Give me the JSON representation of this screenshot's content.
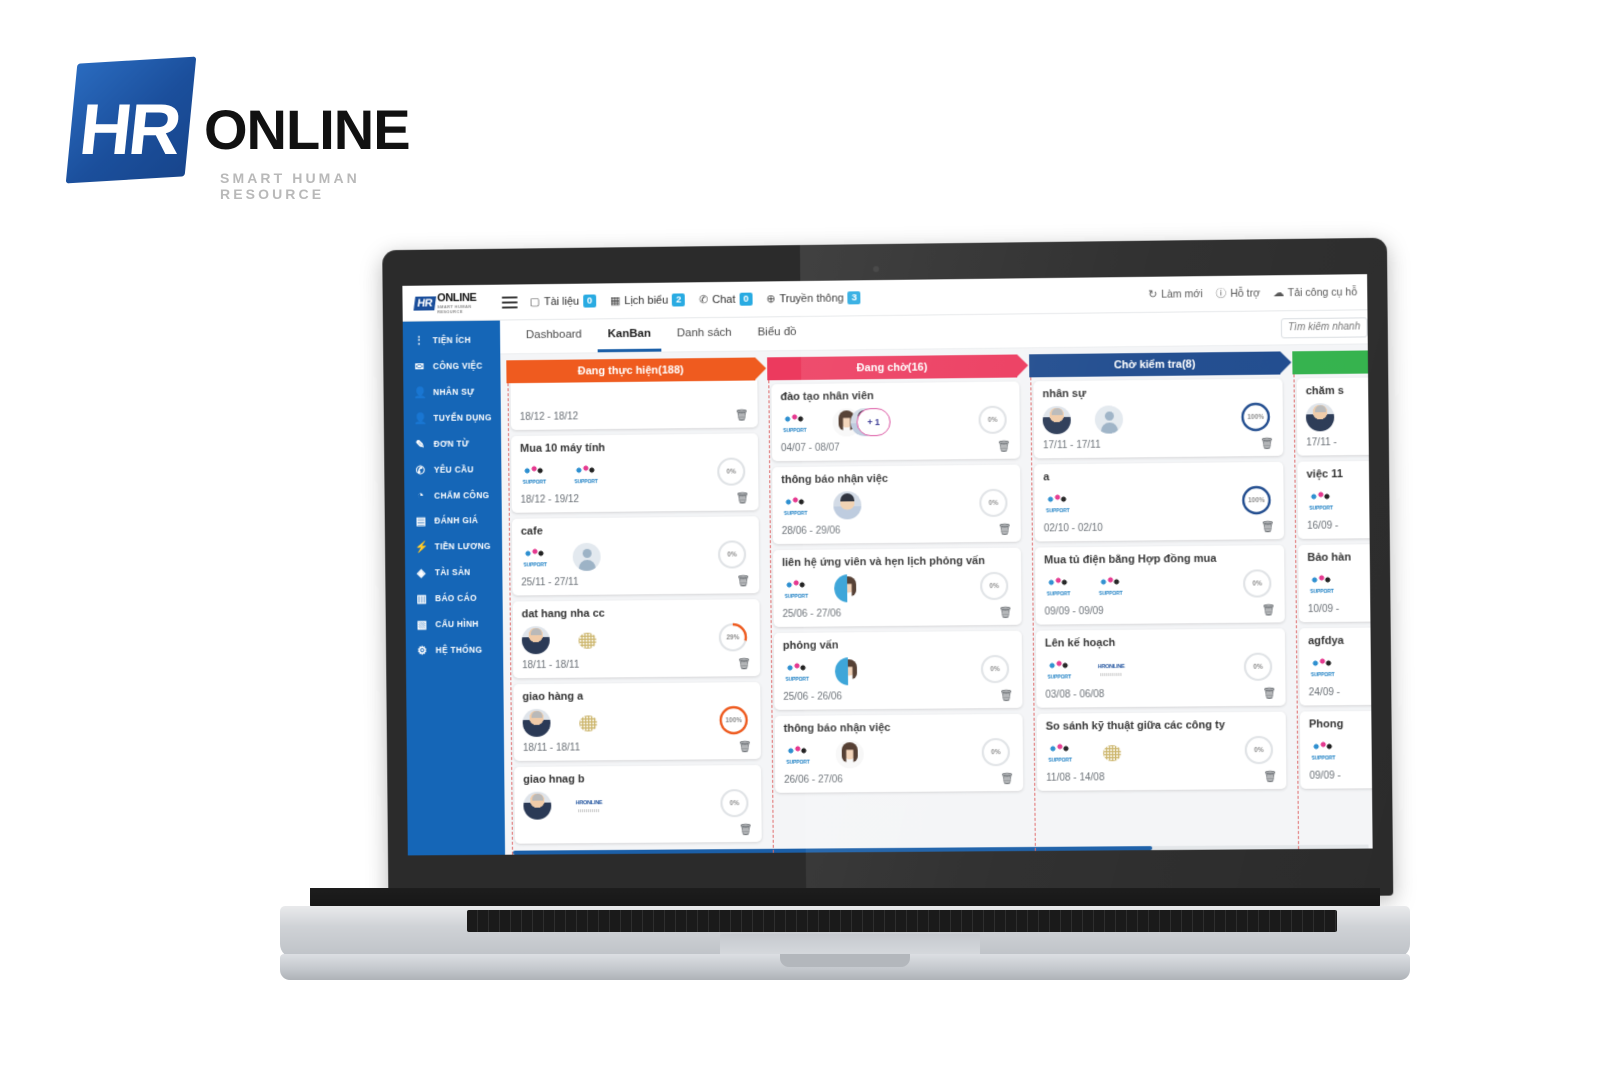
{
  "brand": {
    "hr": "HR",
    "online": "ONLINE",
    "tagline": "SMART HUMAN RESOURCE"
  },
  "topbar": {
    "logo_mark": "HR",
    "logo_text": "ONLINE",
    "logo_sub": "SMART HUMAN RESOURCE",
    "nav": [
      {
        "icon": "document-icon",
        "glyph": "▢",
        "label": "Tài liệu",
        "badge": "0"
      },
      {
        "icon": "calendar-icon",
        "glyph": "▦",
        "label": "Lịch biểu",
        "badge": "2"
      },
      {
        "icon": "chat-icon",
        "glyph": "✆",
        "label": "Chat",
        "badge": "0"
      },
      {
        "icon": "globe-icon",
        "glyph": "⊕",
        "label": "Truyền thông",
        "badge": "3"
      }
    ],
    "right": [
      {
        "icon": "refresh-icon",
        "glyph": "↻",
        "label": "Làm mới"
      },
      {
        "icon": "info-icon",
        "glyph": "ⓘ",
        "label": "Hỗ trợ"
      },
      {
        "icon": "cloud-download-icon",
        "glyph": "☁",
        "label": "Tải công cụ hỗ"
      }
    ],
    "badge_color": "#29abe2"
  },
  "sidebar": {
    "bg": "#1566b7",
    "items": [
      {
        "icon": "dots-vertical-icon",
        "glyph": "⋮",
        "label": "TIỆN ÍCH"
      },
      {
        "icon": "envelope-icon",
        "glyph": "✉",
        "label": "CÔNG VIỆC"
      },
      {
        "icon": "user-icon",
        "glyph": "👤",
        "label": "NHÂN SỰ"
      },
      {
        "icon": "user-plus-icon",
        "glyph": "👤",
        "label": "TUYỂN DỤNG"
      },
      {
        "icon": "edit-icon",
        "glyph": "✎",
        "label": "ĐƠN TỪ"
      },
      {
        "icon": "phone-icon",
        "glyph": "✆",
        "label": "YÊU CẦU"
      },
      {
        "icon": "clock-icon",
        "glyph": "◔",
        "label": "CHẤM CÔNG"
      },
      {
        "icon": "book-icon",
        "glyph": "▤",
        "label": "ĐÁNH GIÁ"
      },
      {
        "icon": "bolt-icon",
        "glyph": "⚡",
        "label": "TIỀN LƯƠNG"
      },
      {
        "icon": "diamond-icon",
        "glyph": "◈",
        "label": "TÀI SẢN"
      },
      {
        "icon": "bar-chart-icon",
        "glyph": "▥",
        "label": "BÁO CÁO"
      },
      {
        "icon": "layers-icon",
        "glyph": "▧",
        "label": "CẤU HÌNH"
      },
      {
        "icon": "gear-icon",
        "glyph": "⚙",
        "label": "HỆ THỐNG"
      }
    ]
  },
  "tabs": [
    {
      "label": "Dashboard",
      "active": false
    },
    {
      "label": "KanBan",
      "active": true
    },
    {
      "label": "Danh sách",
      "active": false
    },
    {
      "label": "Biểu đồ",
      "active": false
    }
  ],
  "search": {
    "placeholder": "Tìm kiếm nhanh",
    "value": ""
  },
  "board": {
    "columns": [
      {
        "title": "Đang thực hiện(188)",
        "color": "#ef5b1f",
        "partial_top_card": {
          "date": "18/12 - 18/12"
        },
        "cards": [
          {
            "title": "Mua 10 máy tính",
            "avatars": [
              "support",
              "support"
            ],
            "progress": "0%",
            "date": "18/12 - 19/12",
            "ring": "#dcdfe3"
          },
          {
            "title": "cafe",
            "avatars": [
              "support",
              "user"
            ],
            "progress": "0%",
            "date": "25/11 - 27/11",
            "ring": "#dcdfe3"
          },
          {
            "title": "dat hang nha cc",
            "avatars": [
              "man",
              "grid"
            ],
            "progress": "29%",
            "date": "18/11 - 18/11",
            "ring": "#ef5b1f"
          },
          {
            "title": "giao hàng a",
            "avatars": [
              "man",
              "grid"
            ],
            "progress": "100%",
            "date": "18/11 - 18/11",
            "ring": "#ef5b1f"
          },
          {
            "title": "giao hnag b",
            "avatars": [
              "man",
              "hronline"
            ],
            "progress": "0%",
            "date": "",
            "ring": "#dcdfe3"
          }
        ]
      },
      {
        "title": "Đang chờ(16)",
        "color": "#e8२",
        "cards": []
      }
    ],
    "columns_full": [
      {
        "id": "col-dang-thuc-hien",
        "title": "Đang thực hiện(188)",
        "color": "#ef5b1f",
        "partial_card_date": "18/12 - 18/12",
        "cards": [
          {
            "title": "Mua 10 máy tính",
            "avatars": [
              "support",
              "support"
            ],
            "progress": "0%",
            "progress_value": 0,
            "date": "18/12 - 19/12",
            "ring_color": "#dcdfe3"
          },
          {
            "title": "cafe",
            "avatars": [
              "support",
              "user"
            ],
            "progress": "0%",
            "progress_value": 0,
            "date": "25/11 - 27/11",
            "ring_color": "#dcdfe3"
          },
          {
            "title": "dat hang nha cc",
            "avatars": [
              "man",
              "grid"
            ],
            "progress": "29%",
            "progress_value": 29,
            "date": "18/11 - 18/11",
            "ring_color": "#ef5b1f"
          },
          {
            "title": "giao hàng a",
            "avatars": [
              "man",
              "grid"
            ],
            "progress": "100%",
            "progress_value": 100,
            "date": "18/11 - 18/11",
            "ring_color": "#ef5b1f"
          },
          {
            "title": "giao hnag b",
            "avatars": [
              "man",
              "hronline"
            ],
            "progress": "0%",
            "progress_value": 0,
            "date": "",
            "ring_color": "#dcdfe3"
          }
        ]
      },
      {
        "id": "col-dang-cho",
        "title": "Đang chờ(16)",
        "color": "#ec3a5e",
        "partial_card_date": "",
        "cards": [
          {
            "title": "đào tạo nhân viên",
            "avatars": [
              "support",
              "womanp",
              "boy",
              "plus"
            ],
            "plus_count": "1",
            "progress": "0%",
            "progress_value": 0,
            "date": "04/07 - 08/07",
            "ring_color": "#dcdfe3"
          },
          {
            "title": "thông báo nhận việc",
            "avatars": [
              "support",
              "boy"
            ],
            "progress": "0%",
            "progress_value": 0,
            "date": "28/06 - 29/06",
            "ring_color": "#dcdfe3"
          },
          {
            "title": "liên hệ ứng viên và hẹn lịch phỏng vấn",
            "avatars": [
              "support",
              "woman"
            ],
            "progress": "0%",
            "progress_value": 0,
            "date": "25/06 - 27/06",
            "ring_color": "#dcdfe3"
          },
          {
            "title": "phỏng vấn",
            "avatars": [
              "support",
              "woman"
            ],
            "progress": "0%",
            "progress_value": 0,
            "date": "25/06 - 26/06",
            "ring_color": "#dcdfe3"
          },
          {
            "title": "thông báo nhận việc",
            "avatars": [
              "support",
              "womanp"
            ],
            "progress": "0%",
            "progress_value": 0,
            "date": "26/06 - 27/06",
            "ring_color": "#dcdfe3"
          }
        ]
      },
      {
        "id": "col-cho-kiem-tra",
        "title": "Chờ kiểm tra(8)",
        "color": "#1f4b8e",
        "partial_card_date": "",
        "cards": [
          {
            "title": "nhân sự",
            "avatars": [
              "man",
              "user"
            ],
            "progress": "100%",
            "progress_value": 100,
            "date": "17/11 - 17/11",
            "ring_color": "#1f4b8e"
          },
          {
            "title": "a",
            "avatars": [
              "support"
            ],
            "progress": "100%",
            "progress_value": 100,
            "date": "02/10 - 02/10",
            "ring_color": "#1f4b8e"
          },
          {
            "title": "Mua tủ điện bằng Hợp đồng mua",
            "avatars": [
              "support",
              "support"
            ],
            "progress": "0%",
            "progress_value": 0,
            "date": "09/09 - 09/09",
            "ring_color": "#dcdfe3"
          },
          {
            "title": "Lên kế hoạch",
            "avatars": [
              "support",
              "hronline"
            ],
            "progress": "0%",
            "progress_value": 0,
            "date": "03/08 - 06/08",
            "ring_color": "#dcdfe3"
          },
          {
            "title": "So sánh kỹ thuật giữa các công ty",
            "avatars": [
              "support",
              "grid"
            ],
            "progress": "0%",
            "progress_value": 0,
            "date": "11/08 - 14/08",
            "ring_color": "#dcdfe3"
          }
        ]
      },
      {
        "id": "col-hoan-thanh",
        "title": "",
        "color": "#33b24c",
        "partial_card_date": "",
        "cards": [
          {
            "title": "chăm s",
            "avatars": [
              "man"
            ],
            "progress": "",
            "progress_value": 0,
            "date": "17/11 -",
            "ring_color": "#dcdfe3"
          },
          {
            "title": "việc 11",
            "avatars": [
              "support"
            ],
            "progress": "",
            "progress_value": 0,
            "date": "16/09 -",
            "ring_color": "#dcdfe3"
          },
          {
            "title": "Bảo hàn",
            "avatars": [
              "support"
            ],
            "progress": "",
            "progress_value": 0,
            "date": "10/09 -",
            "ring_color": "#dcdfe3"
          },
          {
            "title": "agfdya",
            "avatars": [
              "support"
            ],
            "progress": "",
            "progress_value": 0,
            "date": "24/09 -",
            "ring_color": "#dcdfe3"
          },
          {
            "title": "Phong",
            "avatars": [
              "support"
            ],
            "progress": "",
            "progress_value": 0,
            "date": "09/09 -",
            "ring_color": "#dcdfe3"
          }
        ]
      }
    ]
  },
  "icons": {
    "trash": "🗑"
  }
}
